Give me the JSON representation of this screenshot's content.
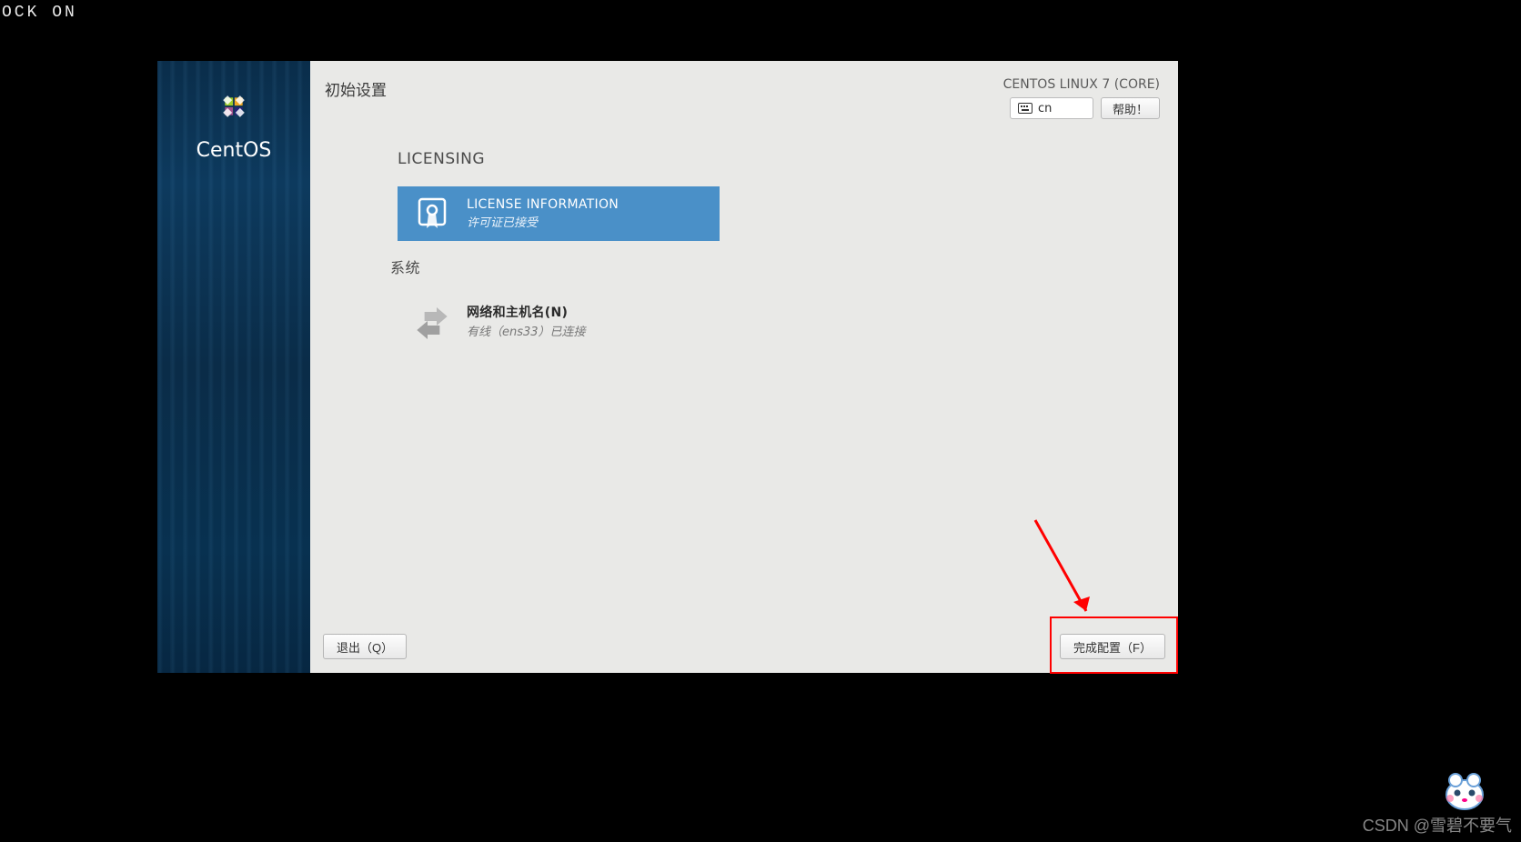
{
  "topbar_fragment": "OCK ON",
  "sidebar": {
    "brand": "CentOS"
  },
  "header": {
    "title": "初始设置",
    "os_name": "CENTOS LINUX 7 (CORE)",
    "lang_code": "cn",
    "help_label": "帮助！"
  },
  "sections": {
    "licensing": {
      "title": "LICENSING",
      "spoke": {
        "title": "LICENSE INFORMATION",
        "status": "许可证已接受"
      }
    },
    "system": {
      "title": "系统",
      "spoke": {
        "title": "网络和主机名(N)",
        "status": "有线（ens33）已连接"
      }
    }
  },
  "footer": {
    "quit": "退出（Q）",
    "finish": "完成配置（F）"
  },
  "watermark": "CSDN @雪碧不要气"
}
